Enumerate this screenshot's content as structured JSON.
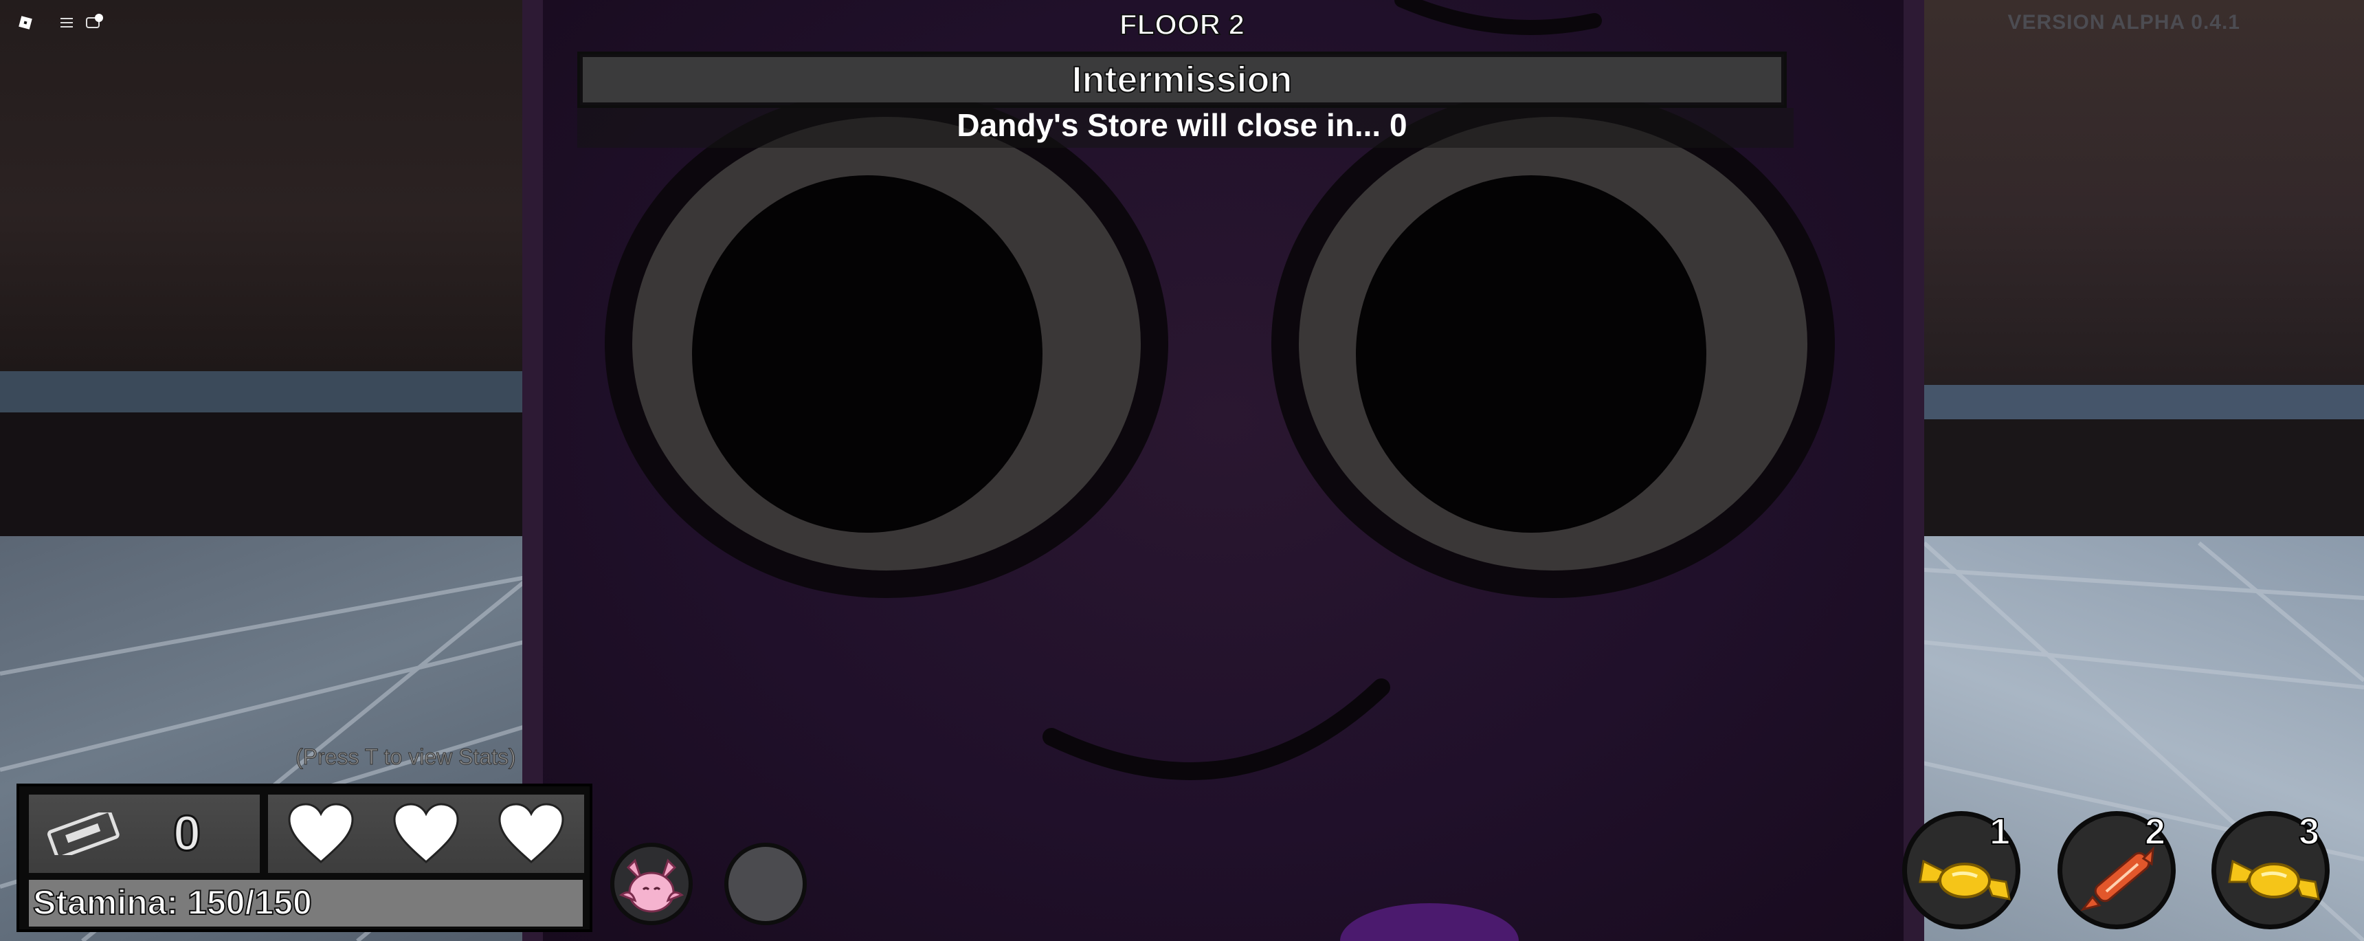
{
  "hud": {
    "floor_title": "FLOOR 2",
    "phase_label": "Intermission",
    "store_message": "Dandy's Store will close in... 0",
    "version": "VERSION ALPHA 0.4.1",
    "stats_hint": "(Press T to view Stats)",
    "tapes_count": "0",
    "hearts": 3,
    "stamina_label": "Stamina: 150/150",
    "stamina": {
      "current": 150,
      "max": 150
    }
  },
  "topbar": {
    "icons": [
      "roblox-icon",
      "menu-icon",
      "chat-icon"
    ],
    "chat_badge": "1"
  },
  "abilities": [
    {
      "name": "character-portrait",
      "icon": "bat-plush-icon"
    },
    {
      "name": "ability-slot-empty",
      "icon": ""
    }
  ],
  "items": [
    {
      "slot": "1",
      "icon": "candy-icon",
      "color": "#f5c518"
    },
    {
      "slot": "2",
      "icon": "firecracker-candy-icon",
      "color": "#e2572b"
    },
    {
      "slot": "3",
      "icon": "candy-icon",
      "color": "#f5c518"
    }
  ],
  "colors": {
    "character_body": "#20102a",
    "eye_ring": "#3a3737",
    "hud_dark": "#0b0b0b",
    "hud_box": "#444444"
  }
}
